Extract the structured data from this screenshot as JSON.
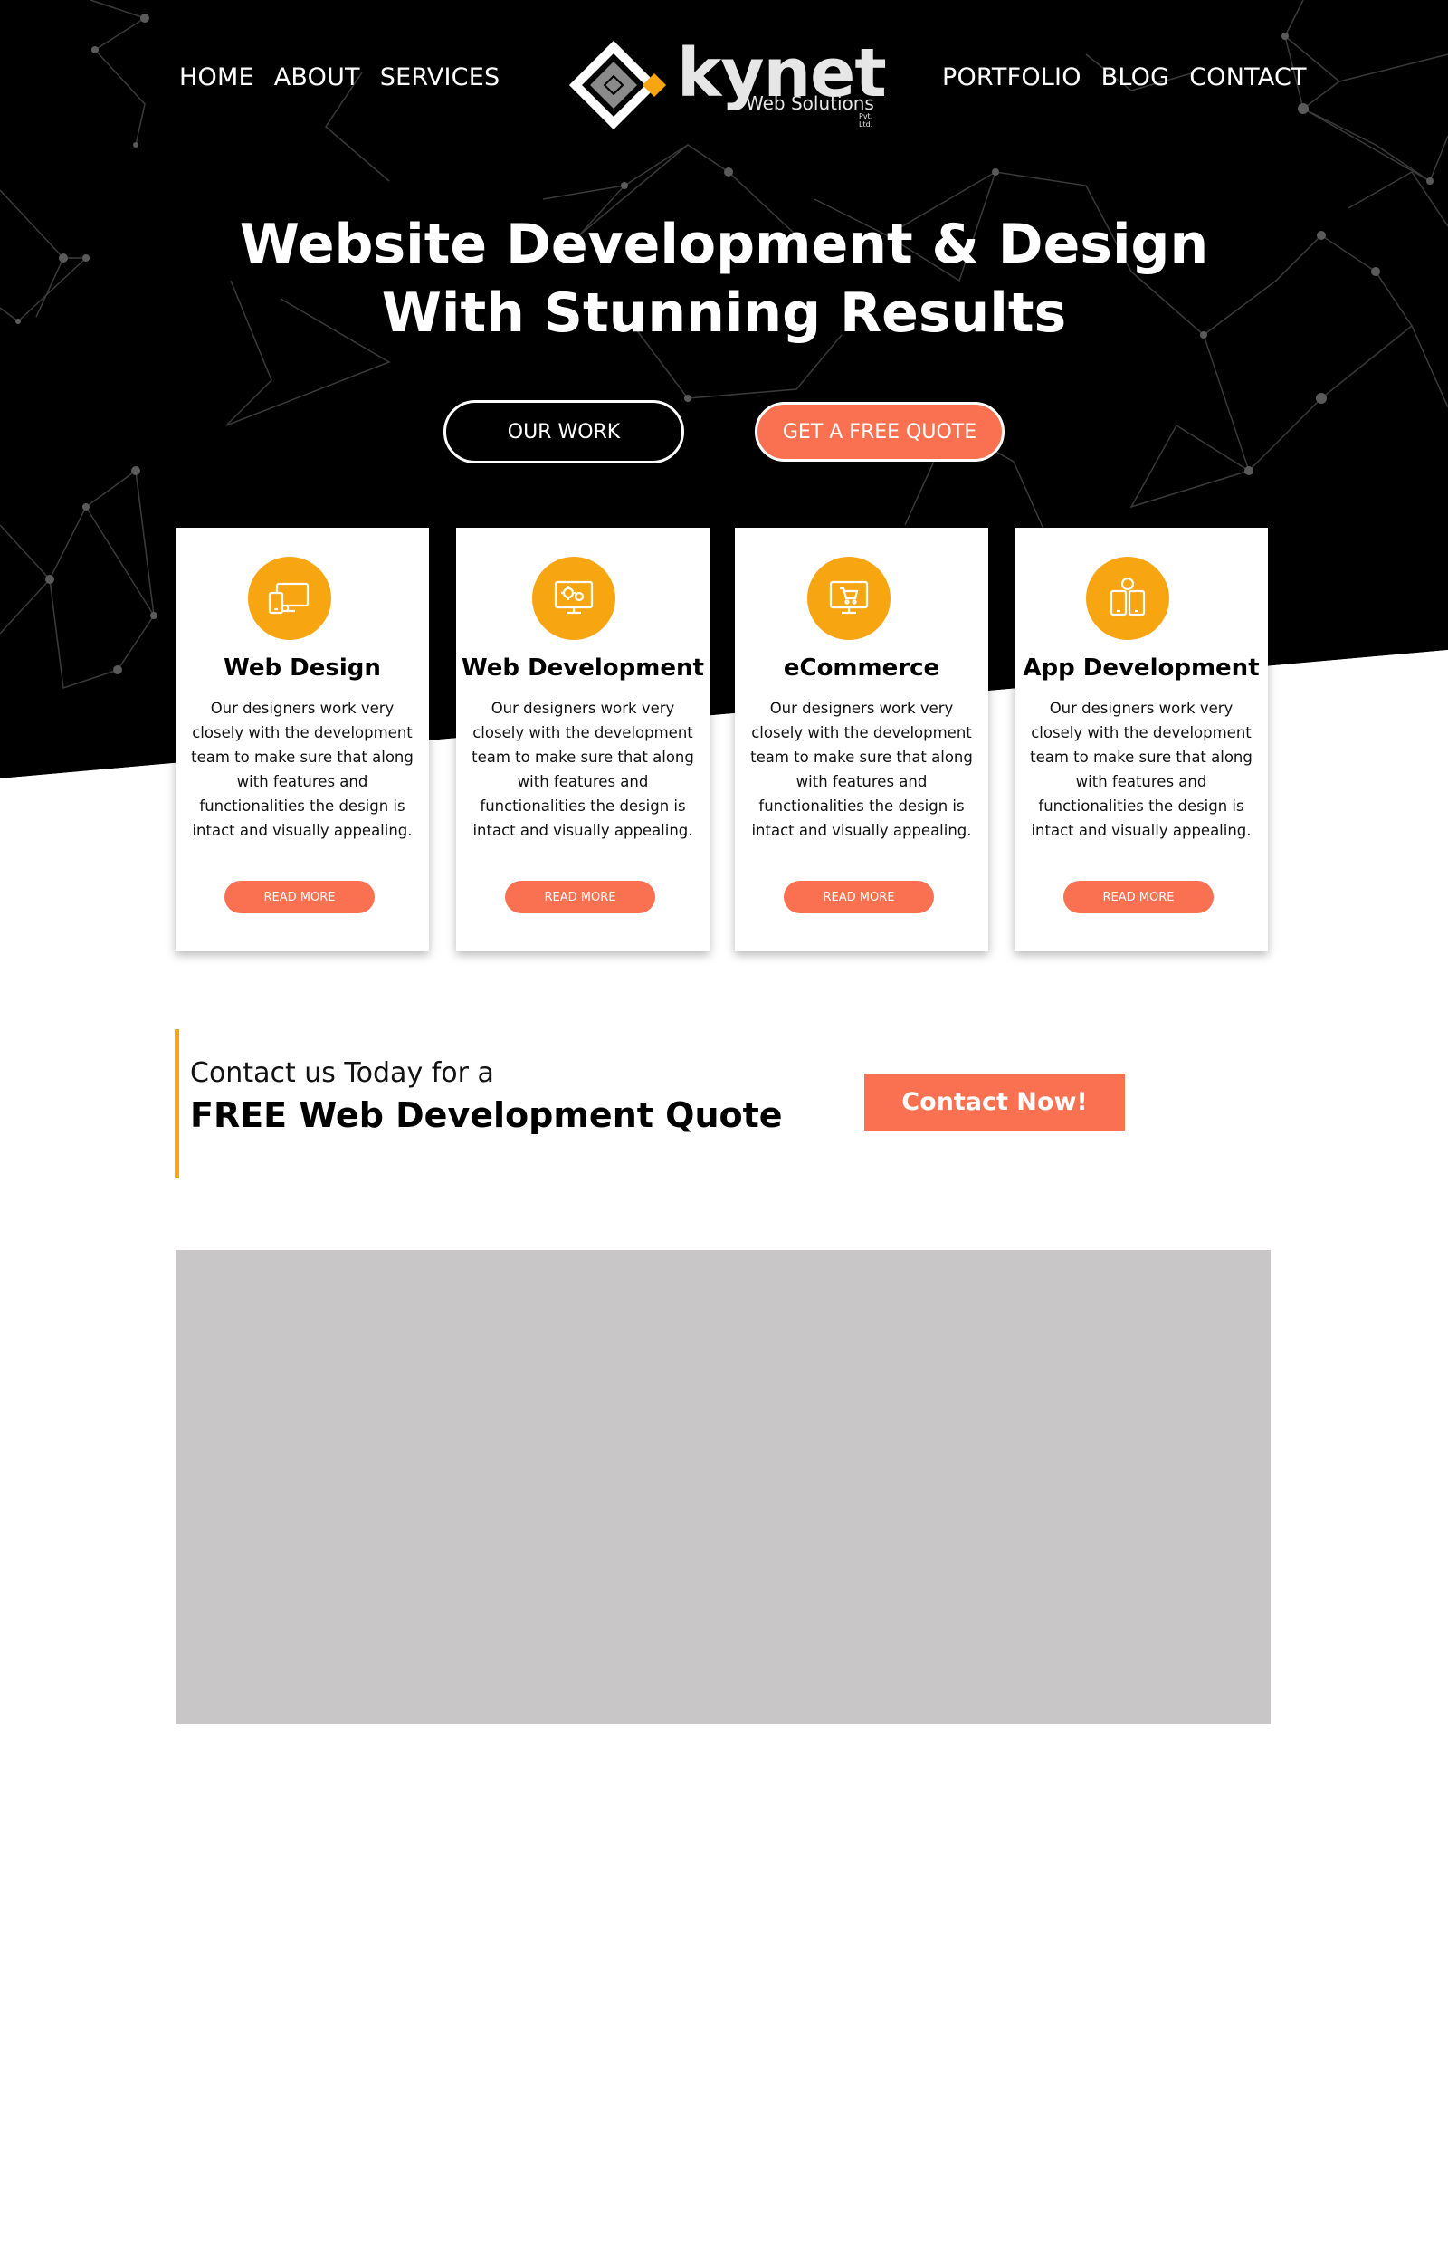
{
  "nav": {
    "left": [
      "HOME",
      "ABOUT",
      "SERVICES"
    ],
    "right": [
      "PORTFOLIO",
      "BLOG",
      "CONTACT"
    ]
  },
  "logo": {
    "name": "kynet",
    "subtitle": "Web Solutions",
    "suffix": "Pvt. Ltd."
  },
  "hero": {
    "title_line1": "Website Development & Design",
    "title_line2": "With Stunning Results",
    "btn_work": "OUR WORK",
    "btn_quote": "GET A FREE QUOTE"
  },
  "services": [
    {
      "title": "Web Design",
      "icon": "devices-icon",
      "text": "Our designers work very closely with the development team to make sure that along with features and functionalities the design is intact and visually appealing.",
      "button": "READ MORE"
    },
    {
      "title": "Web Development",
      "icon": "monitor-gears-icon",
      "text": "Our designers work very closely with the development team to make sure that along with features and functionalities the design is intact and visually appealing.",
      "button": "READ MORE"
    },
    {
      "title": "eCommerce",
      "icon": "monitor-cart-icon",
      "text": "Our designers work very closely with the development team to make sure that along with features and functionalities the design is intact and visually appealing.",
      "button": "READ MORE"
    },
    {
      "title": "App Development",
      "icon": "mobile-apps-icon",
      "text": "Our designers work very closely with the development team to make sure that along with features and functionalities the design is intact and visually appealing.",
      "button": "READ MORE"
    }
  ],
  "cta": {
    "line1": "Contact us Today for a",
    "line2": "FREE Web Development Quote",
    "button": "Contact Now!"
  },
  "colors": {
    "accent": "#f97150",
    "icon_bg": "#f8a512",
    "hero_bg": "#000000",
    "placeholder": "#c8c6c7"
  }
}
